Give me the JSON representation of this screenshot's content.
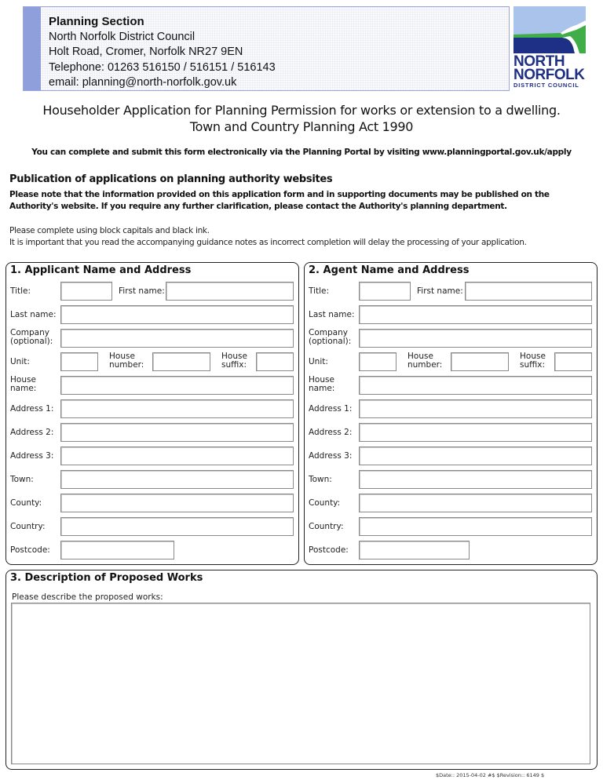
{
  "header": {
    "section": "Planning Section",
    "council": "North Norfolk District Council",
    "address": "Holt Road, Cromer, Norfolk  NR27 9EN",
    "telephone": "Telephone: 01263  516150 / 516151 / 516143",
    "email": "email:  planning@north-norfolk.gov.uk"
  },
  "logo": {
    "line1": "NORTH",
    "line2": "NORFOLK",
    "line3": "DISTRICT COUNCIL",
    "colors": {
      "sky": "#a9c3ea",
      "sea": "#1e2f86",
      "land": "#3fae49",
      "text": "#1e2f86"
    }
  },
  "title": {
    "line1": "Householder Application for Planning Permission for works or extension to a dwelling.",
    "line2": "Town and Country Planning Act 1990"
  },
  "portal_note": "You can complete and submit this form electronically via the Planning Portal by visiting www.planningportal.gov.uk/apply",
  "publication": {
    "heading": "Publication of applications on planning authority websites",
    "text": "Please note that the information provided on this application form and in supporting documents may be published on the Authority's website. If you require any further clarification, please contact the Authority's planning department."
  },
  "guidance": {
    "line1": "Please complete using block capitals and black ink.",
    "line2": "It is important that you read the accompanying guidance notes as incorrect completion will delay the processing of your application."
  },
  "labels": {
    "title": "Title:",
    "first_name": "First name:",
    "last_name": "Last name:",
    "company_1": "Company",
    "company_2": "(optional):",
    "unit": "Unit:",
    "house_number_1": "House",
    "house_number_2": "number:",
    "house_suffix_1": "House",
    "house_suffix_2": "suffix:",
    "house_name_1": "House",
    "house_name_2": "name:",
    "address1": "Address 1:",
    "address2": "Address 2:",
    "address3": "Address 3:",
    "town": "Town:",
    "county": "County:",
    "country": "Country:",
    "postcode": "Postcode:"
  },
  "section1": {
    "title": "1.  Applicant Name and Address"
  },
  "section2": {
    "title": "2.  Agent Name and Address"
  },
  "section3": {
    "title": "3.  Description of Proposed Works",
    "prompt": "Please describe the proposed works:",
    "value": ""
  },
  "footer": "$Date:: 2015-04-02 #$ $Revision:: 6149 $"
}
